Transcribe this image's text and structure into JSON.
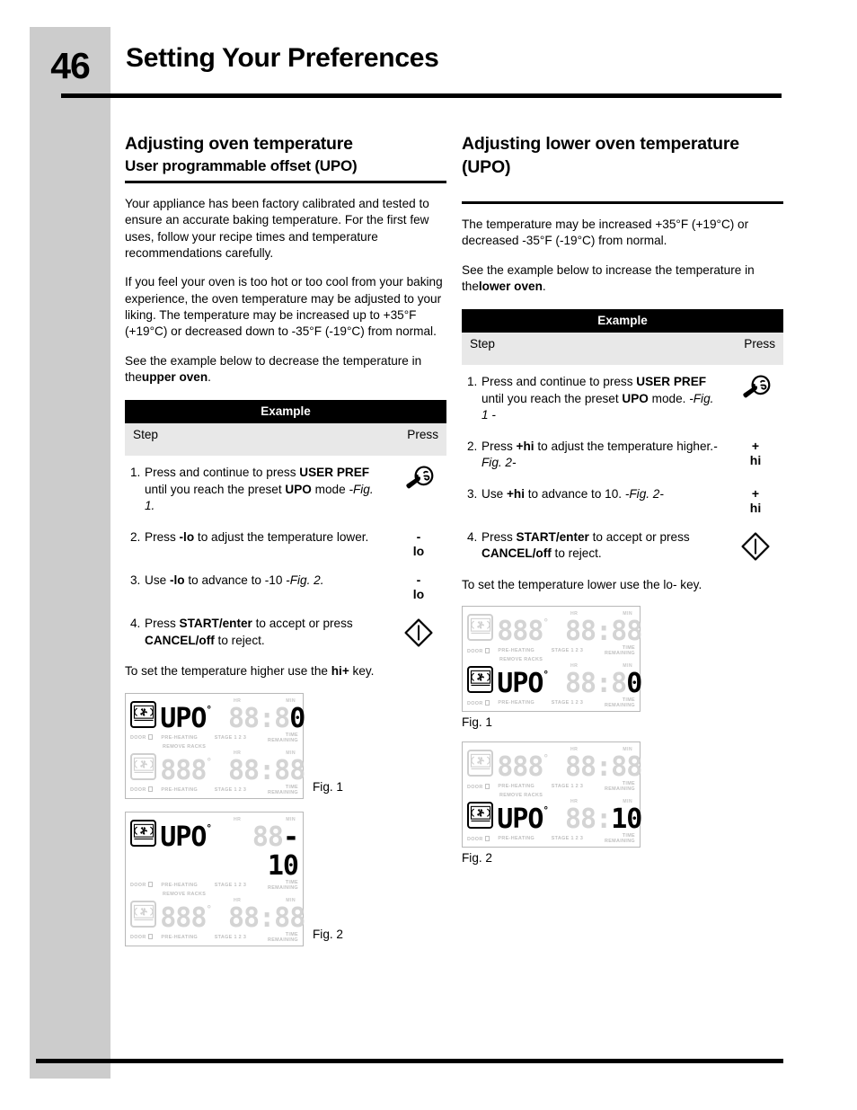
{
  "header": {
    "page_number": "46",
    "title": "Setting Your Preferences"
  },
  "left_column": {
    "heading": "Adjusting oven temperature",
    "subheading": "User programmable offset (UPO)",
    "paragraphs": [
      "Your appliance has been factory calibrated and tested to ensure an accurate baking temperature. For the first few uses, follow your recipe times and temperature recommendations carefully.",
      "If you feel your oven is too hot or too cool from your baking experience, the oven temperature may be adjusted to your liking. The temperature may be increased  up to +35°F (+19°C) or decreased down to -35°F (-19°C) from normal."
    ],
    "see_example": {
      "text_before": "See the example below to decrease the temperature in the",
      "bold": "upper oven",
      "text_after": "."
    },
    "table": {
      "title": "Example",
      "col_step": "Step",
      "col_press": "Press"
    },
    "steps": [
      {
        "num": "1.",
        "parts": [
          {
            "t": "Press and continue to press ",
            "s": "n"
          },
          {
            "t": "USER PREF",
            "s": "b"
          },
          {
            "t": " until you reach the preset ",
            "s": "n"
          },
          {
            "t": "UPO",
            "s": "b"
          },
          {
            "t": " mode",
            "s": "n"
          },
          {
            "t": " -Fig. 1.",
            "s": "i"
          }
        ],
        "press_icon": "user-pref-wrench-icon",
        "press_label": ""
      },
      {
        "num": "2.",
        "parts": [
          {
            "t": "Press ",
            "s": "n"
          },
          {
            "t": "-lo",
            "s": "b"
          },
          {
            "t": " to adjust the temperature lower.",
            "s": "n"
          }
        ],
        "press_icon": "",
        "press_label": {
          "sign": "-",
          "word": "lo"
        }
      },
      {
        "num": "3.",
        "parts": [
          {
            "t": "Use ",
            "s": "n"
          },
          {
            "t": "-lo",
            "s": "b"
          },
          {
            "t": " to advance to -10 ",
            "s": "n"
          },
          {
            "t": "-Fig. 2.",
            "s": "i"
          }
        ],
        "press_icon": "",
        "press_label": {
          "sign": "-",
          "word": "lo"
        }
      },
      {
        "num": "4.",
        "parts": [
          {
            "t": "Press ",
            "s": "n"
          },
          {
            "t": "START/enter",
            "s": "b"
          },
          {
            "t": " to accept or press ",
            "s": "n"
          },
          {
            "t": "CANCEL/off",
            "s": "b"
          },
          {
            "t": " to reject.",
            "s": "n"
          }
        ],
        "press_icon": "start-enter-diamond-icon",
        "press_label": ""
      }
    ],
    "closing": {
      "text_before": "To set the temperature higher use the ",
      "bold": "hi+",
      "text_after": " key."
    },
    "figures": [
      {
        "caption": "Fig. 1",
        "caption_side": "right",
        "active_row": "top",
        "top": {
          "active": true,
          "temp": "UPO",
          "time": "0"
        },
        "bottom": {
          "active": false,
          "temp": "888",
          "time": "88:88"
        }
      },
      {
        "caption": "Fig. 2",
        "caption_side": "right",
        "active_row": "top",
        "top": {
          "active": true,
          "temp": "UPO",
          "time": "-10"
        },
        "bottom": {
          "active": false,
          "temp": "888",
          "time": "88:88"
        }
      }
    ]
  },
  "right_column": {
    "heading": "Adjusting lower oven temperature (UPO)",
    "paragraphs": [
      "The temperature may be increased  +35°F (+19°C) or decreased -35°F (-19°C) from normal."
    ],
    "see_example": {
      "text_before": "See the example below to increase the temperature in the",
      "bold": "lower oven",
      "text_after": "."
    },
    "table": {
      "title": "Example",
      "col_step": "Step",
      "col_press": "Press"
    },
    "steps": [
      {
        "num": "1.",
        "parts": [
          {
            "t": "Press and continue to press ",
            "s": "n"
          },
          {
            "t": "USER PREF",
            "s": "b"
          },
          {
            "t": " until you reach the preset ",
            "s": "n"
          },
          {
            "t": "UPO",
            "s": "b"
          },
          {
            "t": " mode.",
            "s": "n"
          },
          {
            "t": " -Fig. 1 -",
            "s": "i"
          }
        ],
        "press_icon": "user-pref-wrench-icon",
        "press_label": ""
      },
      {
        "num": "2.",
        "parts": [
          {
            "t": "Press ",
            "s": "n"
          },
          {
            "t": "+hi",
            "s": "b"
          },
          {
            "t": " to adjust the temperature higher.",
            "s": "n"
          },
          {
            "t": "-Fig. 2-",
            "s": "i"
          }
        ],
        "press_icon": "",
        "press_label": {
          "sign": "+",
          "word": "hi"
        }
      },
      {
        "num": "3.",
        "parts": [
          {
            "t": "Use ",
            "s": "n"
          },
          {
            "t": "+hi",
            "s": "b"
          },
          {
            "t": " to advance to 10.",
            "s": "n"
          },
          {
            "t": " -Fig. 2-",
            "s": "i"
          }
        ],
        "press_icon": "",
        "press_label": {
          "sign": "+",
          "word": "hi"
        }
      },
      {
        "num": "4.",
        "parts": [
          {
            "t": "Press ",
            "s": "n"
          },
          {
            "t": "START/enter",
            "s": "b"
          },
          {
            "t": " to accept or press ",
            "s": "n"
          },
          {
            "t": "CANCEL/off",
            "s": "b"
          },
          {
            "t": " to reject.",
            "s": "n"
          }
        ],
        "press_icon": "start-enter-diamond-icon",
        "press_label": ""
      }
    ],
    "closing": {
      "text_before": "To set the temperature lower use the lo- key.",
      "bold": "",
      "text_after": ""
    },
    "figures": [
      {
        "caption": "Fig. 1",
        "caption_side": "below",
        "active_row": "bottom",
        "top": {
          "active": false,
          "temp": "888",
          "time": "88:88"
        },
        "bottom": {
          "active": true,
          "temp": "UPO",
          "time": "0"
        }
      },
      {
        "caption": "Fig. 2",
        "caption_side": "below",
        "active_row": "bottom",
        "top": {
          "active": false,
          "temp": "888",
          "time": "88:88"
        },
        "bottom": {
          "active": true,
          "temp": "UPO",
          "time": "10"
        }
      }
    ]
  },
  "lcd_labels": {
    "door": "DOOR",
    "preheating": "PRE-HEATING",
    "stage": "STAGE 1 2 3",
    "time_remaining": "TIME REMAINING",
    "remove_racks": "REMOVE RACKS",
    "hr": "HR",
    "min": "MIN"
  },
  "colors": {
    "spine": "#cccccc",
    "table_header_bg": "#000000",
    "table_subheader_bg": "#e8e8e8",
    "segment_on": "#000000",
    "segment_off": "#d4d4d4"
  }
}
